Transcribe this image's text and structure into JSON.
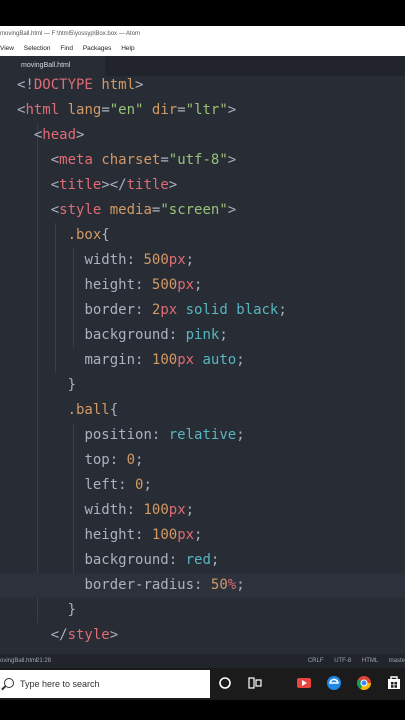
{
  "window": {
    "title": "movingBall.html — F:\\html5\\yossyp\\Box.box — Atom"
  },
  "menu": {
    "items": [
      "View",
      "Selection",
      "Find",
      "Packages",
      "Help"
    ]
  },
  "tab": {
    "label": "movingBall.html"
  },
  "code": {
    "lines": [
      "<!DOCTYPE html>",
      "<html lang=\"en\" dir=\"ltr\">",
      "  <head>",
      "    <meta charset=\"utf-8\">",
      "    <title></title>",
      "    <style media=\"screen\">",
      "      .box{",
      "        width: 500px;",
      "        height: 500px;",
      "        border: 2px solid black;",
      "        background: pink;",
      "        margin: 100px auto;",
      "      }",
      "      .ball{",
      "        position: relative;",
      "        top: 0;",
      "        left: 0;",
      "        width: 100px;",
      "        height: 100px;",
      "        background: red;",
      "        border-radius: 50%;",
      "      }",
      "    </style>"
    ],
    "cursor_line": 20
  },
  "statusbar": {
    "file": "ovingBall.html",
    "position": "21:28",
    "line_ending": "CRLF",
    "encoding": "UTF-8",
    "grammar": "HTML",
    "branch": "maste"
  },
  "taskbar": {
    "search_placeholder": "Type here to search",
    "icons": [
      "cortana-icon",
      "task-view-icon",
      "media-icon",
      "edge-icon",
      "chrome-icon",
      "store-icon"
    ]
  },
  "colors": {
    "editor_bg": "#282c34",
    "tag": "#e06c75",
    "attribute": "#d19a66",
    "string": "#98c379",
    "text": "#abb2bf"
  }
}
